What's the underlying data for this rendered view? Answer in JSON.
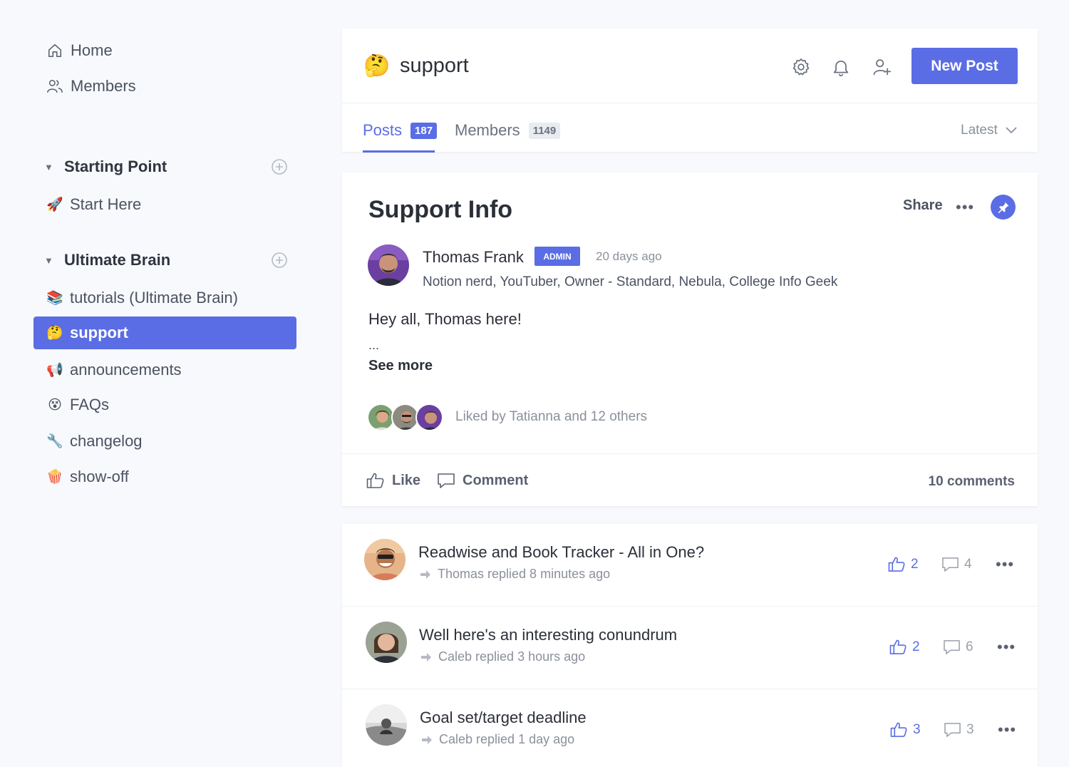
{
  "sidebar": {
    "nav": [
      {
        "label": "Home",
        "icon": "home-icon"
      },
      {
        "label": "Members",
        "icon": "members-icon"
      }
    ],
    "groups": [
      {
        "title": "Starting Point",
        "items": [
          {
            "label": "Start Here",
            "emoji": "🚀"
          }
        ]
      },
      {
        "title": "Ultimate Brain",
        "items": [
          {
            "label": "tutorials (Ultimate Brain)",
            "emoji": "📚"
          },
          {
            "label": "support",
            "emoji": "🤔",
            "active": true
          },
          {
            "label": "announcements",
            "emoji": "📢"
          },
          {
            "label": "FAQs",
            "emoji": "😵"
          },
          {
            "label": "changelog",
            "emoji": "🔧"
          },
          {
            "label": "show-off",
            "emoji": "🍿"
          }
        ]
      }
    ]
  },
  "header": {
    "emoji": "🤔",
    "title": "support",
    "new_post_label": "New Post",
    "tabs": [
      {
        "label": "Posts",
        "count": "187",
        "active": true
      },
      {
        "label": "Members",
        "count": "1149",
        "active": false
      }
    ],
    "sort_label": "Latest"
  },
  "pinned_post": {
    "title": "Support Info",
    "share_label": "Share",
    "more_label": "•••",
    "author": {
      "name": "Thomas Frank",
      "badge": "ADMIN",
      "time": "20 days ago",
      "bio": "Notion nerd, YouTuber, Owner - Standard, Nebula, College Info Geek"
    },
    "body": "Hey all, Thomas here!",
    "ellipsis": "...",
    "see_more_label": "See more",
    "liked_by": "Liked by Tatianna and 12 others",
    "like_label": "Like",
    "comment_label": "Comment",
    "comment_count": "10 comments"
  },
  "threads": [
    {
      "title": "Readwise and Book Tracker - All in One?",
      "subtitle": "Thomas replied 8 minutes ago",
      "likes": "2",
      "comments": "4"
    },
    {
      "title": "Well here's an interesting conundrum",
      "subtitle": "Caleb replied 3 hours ago",
      "likes": "2",
      "comments": "6"
    },
    {
      "title": "Goal set/target deadline",
      "subtitle": "Caleb replied 1 day ago",
      "likes": "3",
      "comments": "3"
    }
  ],
  "colors": {
    "accent": "#5a6de5",
    "background": "#f8f9fc",
    "text": "#343a46",
    "muted": "#8a909c"
  }
}
